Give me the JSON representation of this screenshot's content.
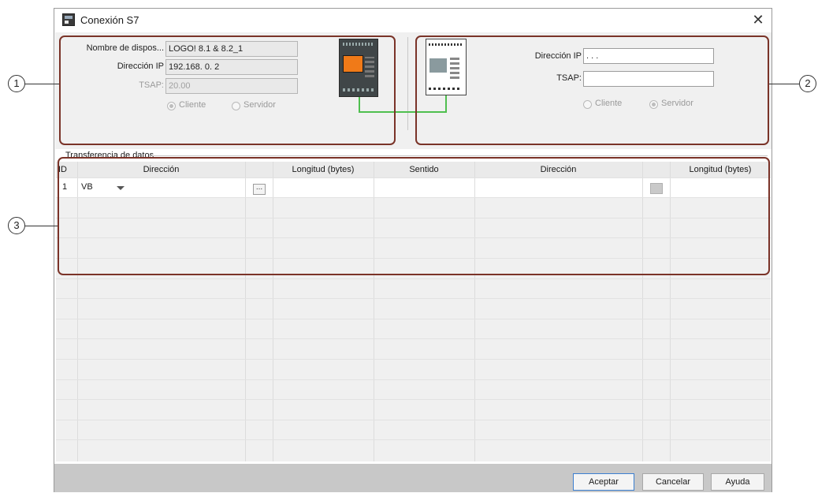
{
  "window": {
    "title": "Conexión S7",
    "close_icon": "close-icon"
  },
  "local": {
    "device_name_label": "Nombre de dispos...",
    "device_name_value": "LOGO! 8.1 & 8.2_1",
    "ip_label": "Dirección IP",
    "ip_value": "192.168.  0.  2",
    "tsap_label": "TSAP:",
    "tsap_value": "20.00",
    "client_label": "Cliente",
    "server_label": "Servidor",
    "selected": "client"
  },
  "remote": {
    "ip_label": "Dirección IP",
    "ip_value": ".  .  .",
    "tsap_label": "TSAP:",
    "tsap_value": "",
    "client_label": "Cliente",
    "server_label": "Servidor",
    "selected": "server"
  },
  "transfer": {
    "title": "Transferencia de datos",
    "columns": [
      "ID",
      "Dirección",
      "",
      "Longitud (bytes)",
      "Sentido",
      "Dirección",
      "",
      "Longitud (bytes)"
    ],
    "rows": [
      {
        "id": "1",
        "address": "VB",
        "length": "",
        "direction": "",
        "remote_address": "",
        "remote_length": ""
      }
    ]
  },
  "buttons": {
    "ok": "Aceptar",
    "cancel": "Cancelar",
    "help": "Ayuda"
  },
  "annotations": [
    "1",
    "2",
    "3"
  ],
  "colors": {
    "annotation": "#7a3328",
    "link_line": "#4fbf4f",
    "device_screen": "#f07a18"
  }
}
